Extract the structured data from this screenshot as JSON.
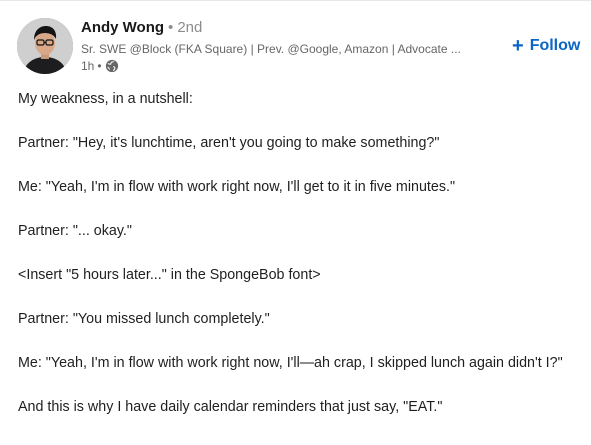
{
  "post": {
    "author": {
      "name": "Andy Wong",
      "separator": "•",
      "degree": "2nd",
      "headline": "Sr. SWE @Block (FKA Square) | Prev. @Google, Amazon | Advocate ...",
      "time": "1h",
      "time_separator": "•",
      "visibility_icon": "globe-icon",
      "avatar_icon": "avatar"
    },
    "follow_button": {
      "plus": "+",
      "label": "Follow"
    },
    "lines": [
      "My weakness, in a nutshell:",
      "Partner: \"Hey, it's lunchtime, aren't you going to make something?\"",
      "Me: \"Yeah, I'm in flow with work right now, I'll get to it in five minutes.\"",
      "Partner: \"... okay.\"",
      "<Insert \"5 hours later...\" in the SpongeBob font>",
      "Partner: \"You missed lunch completely.\"",
      "Me: \"Yeah, I'm in flow with work right now, I'll—ah crap, I skipped lunch again didn't I?\"",
      "And this is why I have daily calendar reminders that just say, \"EAT.\""
    ]
  },
  "colors": {
    "link_blue": "#0a66c2",
    "muted_text": "#666666",
    "body_text": "#1f1f1f"
  }
}
